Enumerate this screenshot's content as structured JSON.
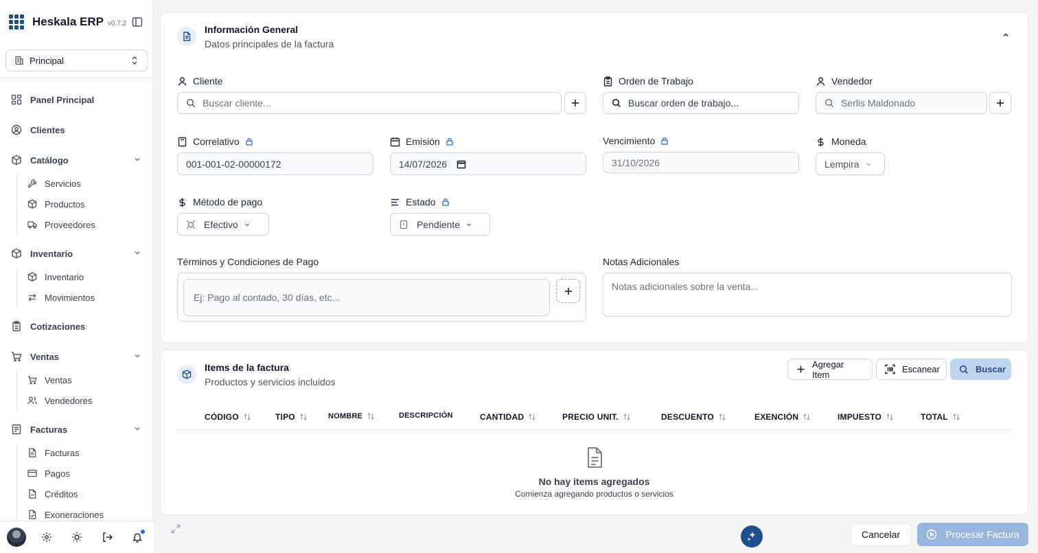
{
  "app": {
    "name": "Heskala ERP",
    "version": "v0.7.2"
  },
  "workspace": {
    "label": "Principal"
  },
  "sidebar": {
    "panel": "Panel Principal",
    "clientes": "Clientes",
    "catalogo": {
      "label": "Catálogo",
      "items": [
        "Servicios",
        "Productos",
        "Proveedores"
      ]
    },
    "inventario": {
      "label": "Inventario",
      "items": [
        "Inventario",
        "Movimientos"
      ]
    },
    "cotizaciones": "Cotizaciones",
    "ventas": {
      "label": "Ventas",
      "items": [
        "Ventas",
        "Vendedores"
      ]
    },
    "facturas": {
      "label": "Facturas",
      "items": [
        "Facturas",
        "Pagos",
        "Créditos",
        "Exoneraciones"
      ]
    }
  },
  "general": {
    "title": "Información General",
    "subtitle": "Datos principales de la factura",
    "cliente": {
      "label": "Cliente",
      "placeholder": "Buscar cliente..."
    },
    "orden": {
      "label": "Orden de Trabajo",
      "placeholder": "Buscar orden de trabajo..."
    },
    "vendedor": {
      "label": "Vendedor",
      "value": "Serlis Maldonado"
    },
    "correlativo": {
      "label": "Correlativo",
      "value": "001-001-02-00000172"
    },
    "emision": {
      "label": "Emisión",
      "value": "14/07/2026"
    },
    "vencimiento": {
      "label": "Vencimiento",
      "value": "31/10/2026"
    },
    "moneda": {
      "label": "Moneda",
      "value": "Lempira"
    },
    "metodo": {
      "label": "Método de pago",
      "value": "Efectivo"
    },
    "estado": {
      "label": "Estado",
      "value": "Pendiente"
    },
    "terminos": {
      "label": "Términos y Condiciones de Pago",
      "placeholder": "Ej: Pago al contado, 30 días, etc..."
    },
    "notas": {
      "label": "Notas Adicionales",
      "placeholder": "Notas adicionales sobre la venta..."
    }
  },
  "items": {
    "title": "Items de la factura",
    "subtitle": "Productos y servicios incluidos",
    "actions": {
      "add": "Agregar Item",
      "scan": "Escanear",
      "search": "Buscar"
    },
    "columns": [
      "CÓDIGO",
      "TIPO",
      "NOMBRE",
      "DESCRIPCIÓN",
      "CANTIDAD",
      "PRECIO UNIT.",
      "DESCUENTO",
      "EXENCIÓN",
      "IMPUESTO",
      "TOTAL"
    ],
    "empty": {
      "title": "No hay items agregados",
      "subtitle": "Comienza agregando productos o servicios"
    }
  },
  "footer": {
    "cancel": "Cancelar",
    "process": "Procesar Factura"
  },
  "colors": {
    "primary": "#1e4e8c",
    "primary_light": "#bfd4ee",
    "process": "#98b6dd",
    "brand_grid": "#1e4e8c"
  }
}
